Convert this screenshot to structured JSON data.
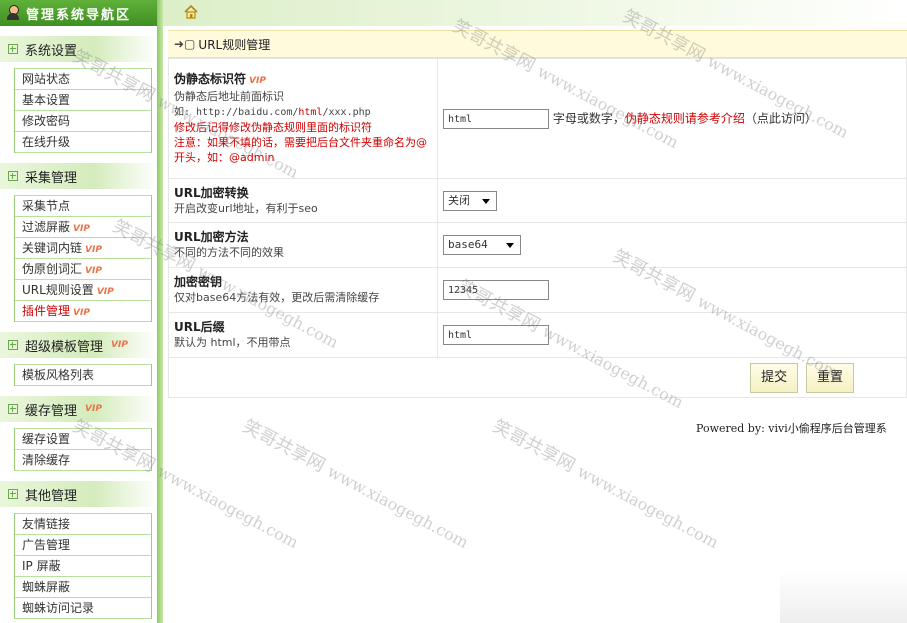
{
  "sidebar": {
    "title": "管理系统导航区",
    "vip_badge": "VIP",
    "groups": [
      {
        "label": "系统设置",
        "items": [
          {
            "label": "网站状态"
          },
          {
            "label": "基本设置"
          },
          {
            "label": "修改密码"
          },
          {
            "label": "在线升级"
          }
        ]
      },
      {
        "label": "采集管理",
        "items": [
          {
            "label": "采集节点"
          },
          {
            "label": "过滤屏蔽"
          },
          {
            "label": "关键词内链"
          },
          {
            "label": "伪原创词汇"
          },
          {
            "label": "URL规则设置"
          },
          {
            "label": "插件管理"
          }
        ]
      },
      {
        "label": "超级模板管理",
        "items": [
          {
            "label": "模板风格列表"
          }
        ]
      },
      {
        "label": "缓存管理",
        "items": [
          {
            "label": "缓存设置"
          },
          {
            "label": "清除缓存"
          }
        ]
      },
      {
        "label": "其他管理",
        "items": [
          {
            "label": "友情链接"
          },
          {
            "label": "广告管理"
          },
          {
            "label": "IP 屏蔽"
          },
          {
            "label": "蜘蛛屏蔽"
          },
          {
            "label": "蜘蛛访问记录"
          }
        ]
      }
    ]
  },
  "panel": {
    "title": "URL规则管理",
    "rows": {
      "r1": {
        "label": "伪静态标识符",
        "desc1": "伪静态后地址前面标识",
        "example_prefix": "如: http://baidu.com/",
        "example_mark": "html",
        "example_suffix": "/xxx.php",
        "note1": "修改后记得修改伪静态规则里面的标识符",
        "note2": "注意：如果不填的话，需要把后台文件夹重命名为@开头，如：@admin",
        "value": "html",
        "hint": "字母或数字，",
        "hint_red": "伪静态规则请参考介绍",
        "hint_tail": "（点此访问）"
      },
      "r2": {
        "label": "URL加密转换",
        "desc": "开启改变url地址，有利于seo",
        "value": "关闭"
      },
      "r3": {
        "label": "URL加密方法",
        "desc": "不同的方法不同的效果",
        "value": "base64"
      },
      "r4": {
        "label": "加密密钥",
        "desc": "仅对base64方法有效，更改后需清除缓存",
        "value": "12345"
      },
      "r5": {
        "label": "URL后缀",
        "desc": "默认为 html，不用带点",
        "value": "html"
      }
    },
    "submit_label": "提交",
    "reset_label": "重置"
  },
  "footer": {
    "text": "Powered by:  vivi小偷程序后台管理系"
  },
  "watermark": {
    "text": "笑哥共享网",
    "url": "www.xiaogegh.com"
  }
}
